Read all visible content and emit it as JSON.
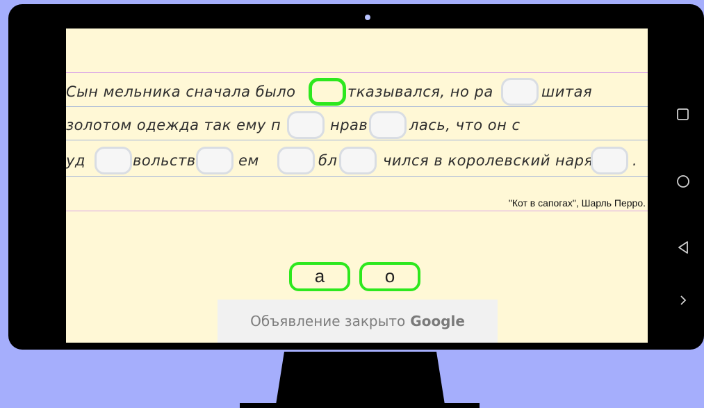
{
  "exercise": {
    "lines": [
      {
        "segments": [
          "Сын мельника сначала было",
          "тказывался, но ра",
          "шитая"
        ]
      },
      {
        "segments": [
          "золотом одежда так ему п",
          "нрав",
          "лась, что он с"
        ]
      },
      {
        "segments": [
          "уд",
          "вольств",
          "ем",
          "бл",
          "чился в королевский наря",
          "."
        ]
      }
    ],
    "attribution": "\"Кот в сапогах\", Шарль Перро."
  },
  "choices": [
    "а",
    "о"
  ],
  "ad": {
    "text": "Объявление закрыто",
    "brand": "Google"
  },
  "navbar": [
    "square-icon",
    "circle-icon",
    "back-triangle-icon",
    "chevron-right-icon"
  ],
  "colors": {
    "accent_green": "#2de81e",
    "paper": "#fff8d6",
    "background": "#a5aefc",
    "device": "#000000"
  }
}
